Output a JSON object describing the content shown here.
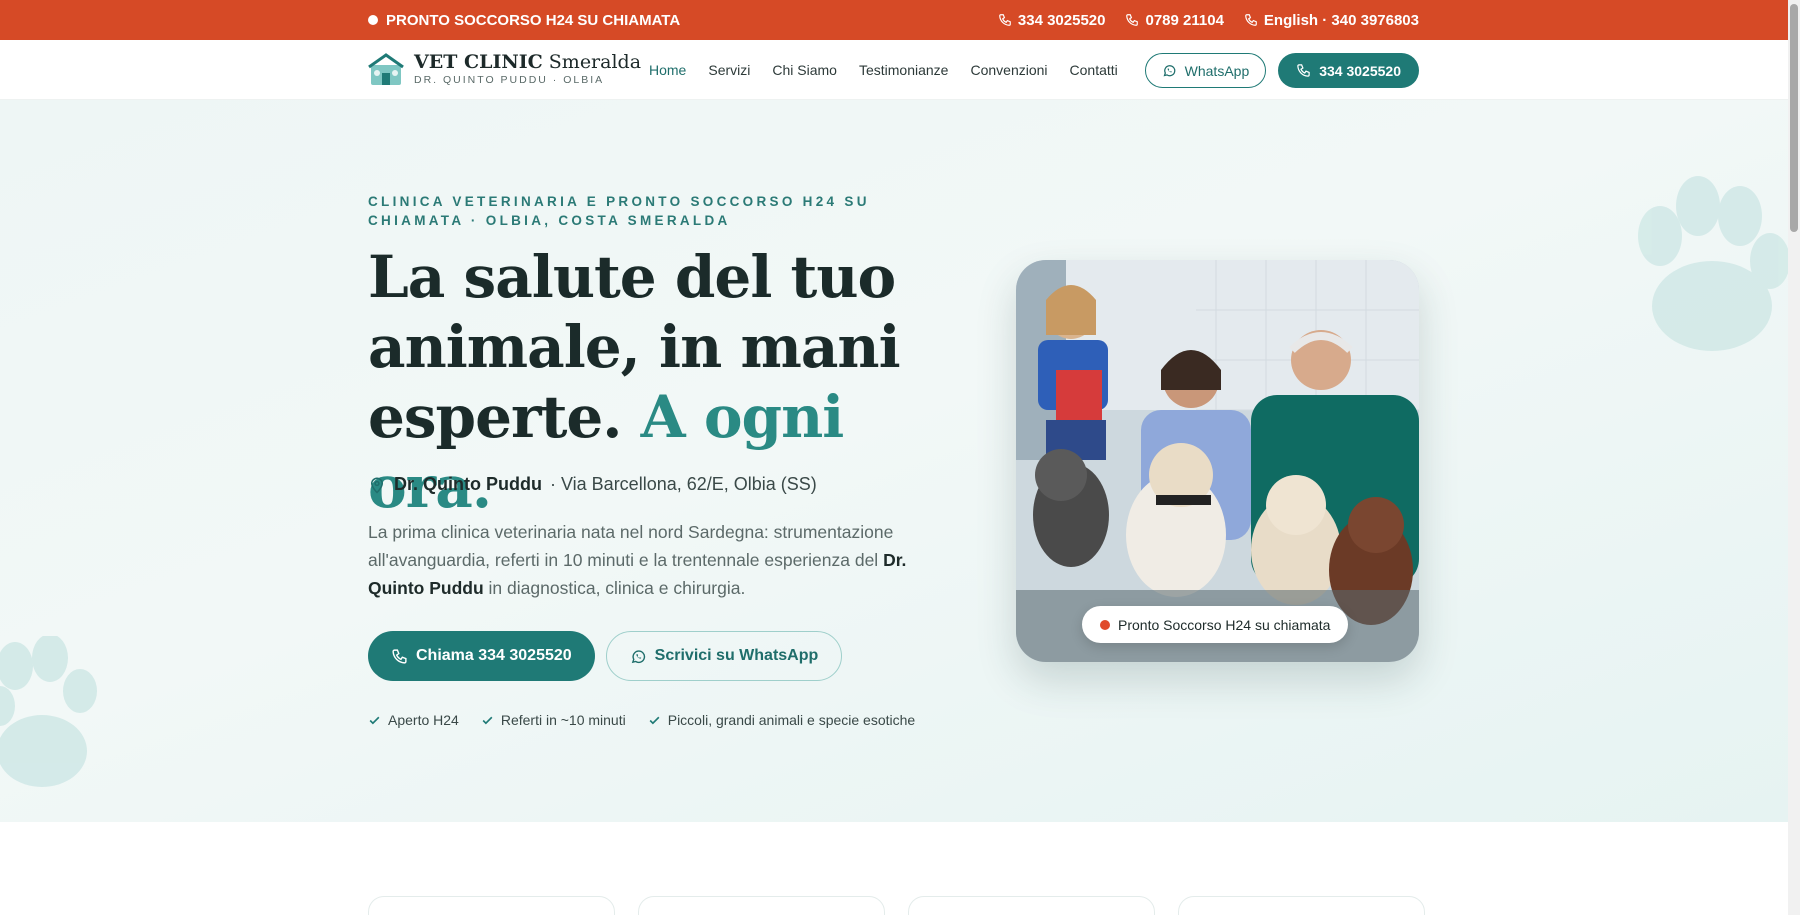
{
  "topbar": {
    "alert": "PRONTO SOCCORSO H24 SU CHIAMATA",
    "phones": [
      "334 3025520",
      "0789 21104",
      "English · 340 3976803"
    ],
    "bg_color": "#d64a26"
  },
  "brand": {
    "name_bold": "VET CLINIC",
    "name_light": "Smeralda",
    "subtitle": "DR. QUINTO PUDDU · OLBIA"
  },
  "nav": {
    "items": [
      "Home",
      "Servizi",
      "Chi Siamo",
      "Testimonianze",
      "Convenzioni",
      "Contatti"
    ],
    "active": "Home",
    "whatsapp_label": "WhatsApp",
    "phone_label": "334 3025520"
  },
  "hero": {
    "eyebrow": "CLINICA VETERINARIA E PRONTO SOCCORSO H24 SU CHIAMATA · OLBIA, COSTA SMERALDA",
    "headline_line1": "La salute del tuo",
    "headline_line2": "animale, in mani",
    "headline_line3": "esperte.",
    "headline_accent": "A ogni ora.",
    "address_name": "Dr. Quinto Puddu",
    "address_rest": "· Via Barcellona, 62/E, Olbia (SS)",
    "lead_part1": "La prima clinica veterinaria nata nel nord Sardegna: strumentazione all'avanguardia, referti in 10 minuti e la trentennale esperienza del",
    "lead_bold": "Dr. Quinto Puddu",
    "lead_part2": "in diagnostica, clinica e chirurgia.",
    "cta_call": "Chiama 334 3025520",
    "cta_whatsapp": "Scrivici su WhatsApp",
    "checks": [
      "Aperto H24",
      "Referti in ~10 minuti",
      "Piccoli, grandi animali e specie esotiche"
    ],
    "photo_badge": "Pronto Soccorso H24 su chiamata"
  },
  "colors": {
    "accent": "#1f7a76",
    "accent_text": "#2a8a84",
    "alert": "#d64a26"
  }
}
